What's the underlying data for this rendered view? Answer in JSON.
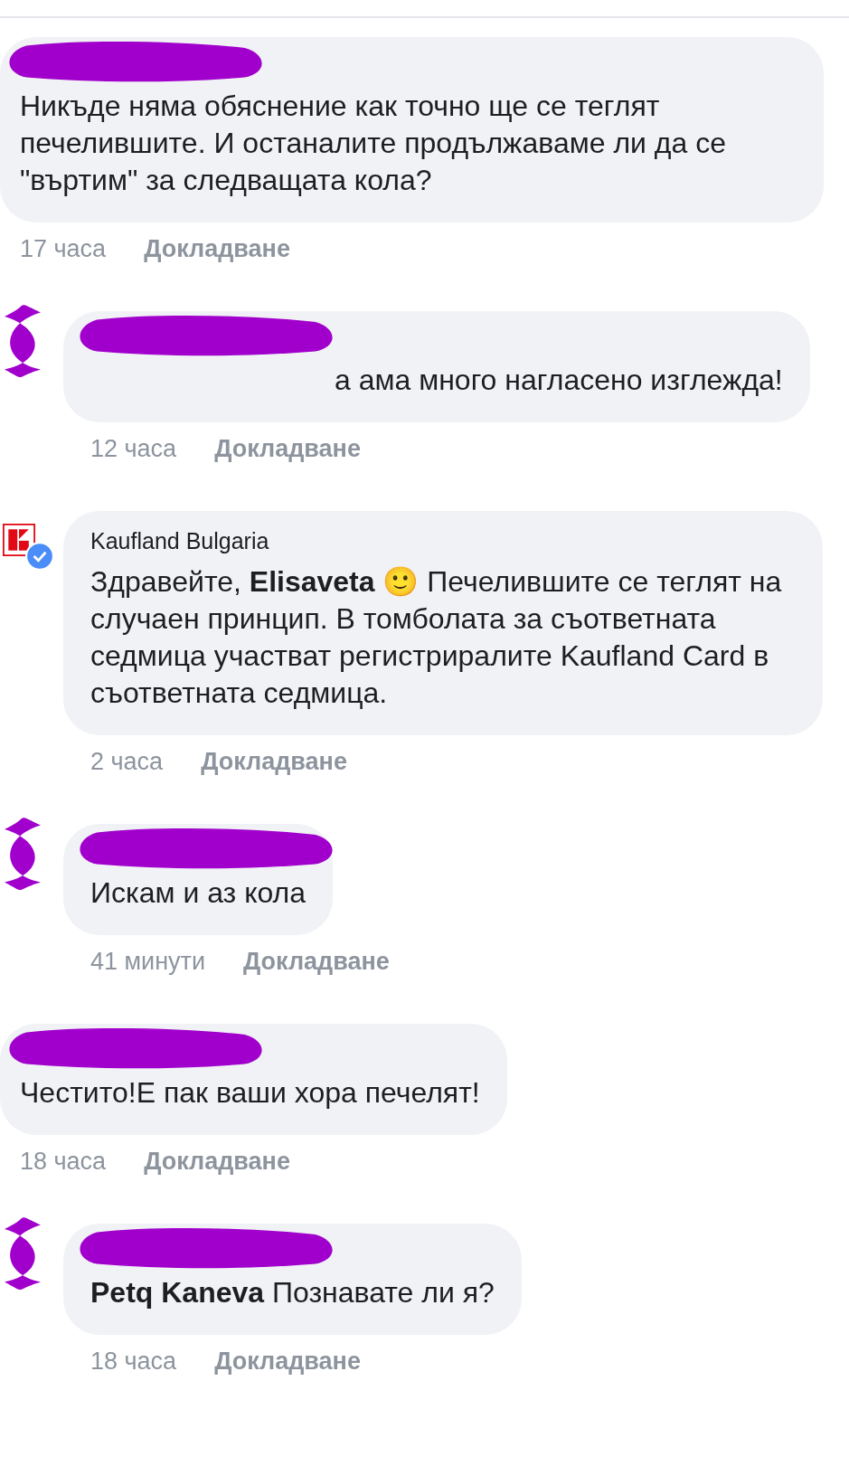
{
  "comments": [
    {
      "kind": "user",
      "avatar_redacted": false,
      "name_redacted": true,
      "text": "Никъде няма обяснение как точно ще се теглят печелившите. И останалите продължаваме ли да се \"въртим\" за следващата кола?",
      "time": "17 часа",
      "action": "Докладване"
    },
    {
      "kind": "user",
      "avatar_redacted": true,
      "name_redacted": true,
      "text": "а ама много нагласено изглежда!",
      "time": "12 часа",
      "action": "Докладване"
    },
    {
      "kind": "page",
      "verified": true,
      "author": "Kaufland Bulgaria",
      "text": "Здравейте, **Elisaveta** 🙂 Печелившите се теглят на случаен принцип. В томболата за съответната седмица участват регистриралите Kaufland Card в съответната седмица.",
      "time": "2 часа",
      "action": "Докладване"
    },
    {
      "kind": "user",
      "avatar_redacted": true,
      "name_redacted": true,
      "text": "Искам и аз кола",
      "time": "41 минути",
      "action": "Докладване"
    },
    {
      "kind": "user",
      "avatar_redacted": false,
      "name_redacted": true,
      "text": "Честито!Е пак ваши хора печелят!",
      "time": "18 часа",
      "action": "Докладване"
    },
    {
      "kind": "user",
      "avatar_redacted": true,
      "name_redacted": true,
      "text": "**Petq Kaneva** Познавате ли я?",
      "time": "18 часа",
      "action": "Докладване"
    }
  ]
}
